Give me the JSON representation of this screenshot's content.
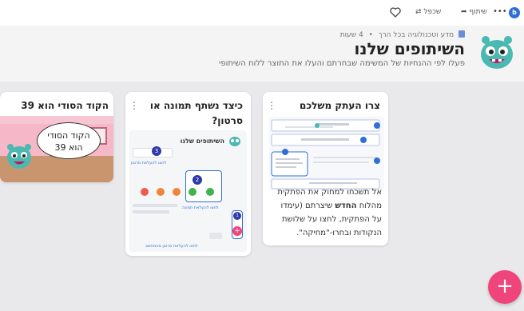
{
  "topbar": {
    "share_label": "שיתוף",
    "remix_label": "שכפל",
    "more_icon": "more-icon",
    "heart_icon": "heart-icon",
    "brand_letter": "b"
  },
  "header": {
    "breadcrumb_course": "מדע וטכנולוגיה בכל הרך",
    "breadcrumb_separator": "•",
    "breadcrumb_time": "4 שעות",
    "title": "השיתופים שלנו",
    "subtitle": "פעלו לפי ההנחיות של המשימה שבחרתם והעלו את התוצר ללוח השיתופי"
  },
  "cards": [
    {
      "title": "צרו העתק משלכם",
      "body_line1": "אל תשכחו למחוק את הפתקית",
      "body_line2_a": "מהלוח ",
      "body_line2_b": "החדש",
      "body_line2_c": " שיצרתם (עימדו",
      "body_line3": "על הפתקית, לחצו על שלושת",
      "body_line4": "הנקודות ובחרו-\"מחיקה\"."
    },
    {
      "title": "כיצד נשתף תמונה או סרטון?",
      "inner_title": "השיתופים שלנו",
      "inner_caption1": "לחצו להעלאת סרטון",
      "inner_caption2": "לחצו להעלאת תמונה",
      "inner_caption3": "לחצו להעלאת סרטון מהמחשב"
    },
    {
      "title": "הקוד הסודי הוא 39",
      "bubble_line1": "הקוד הסודי",
      "bubble_line2": "הוא 39"
    }
  ],
  "fab": {
    "label": "+"
  },
  "colors": {
    "accent": "#f0457a",
    "brand": "#2f6fd6",
    "mascot": "#49b9b2"
  }
}
